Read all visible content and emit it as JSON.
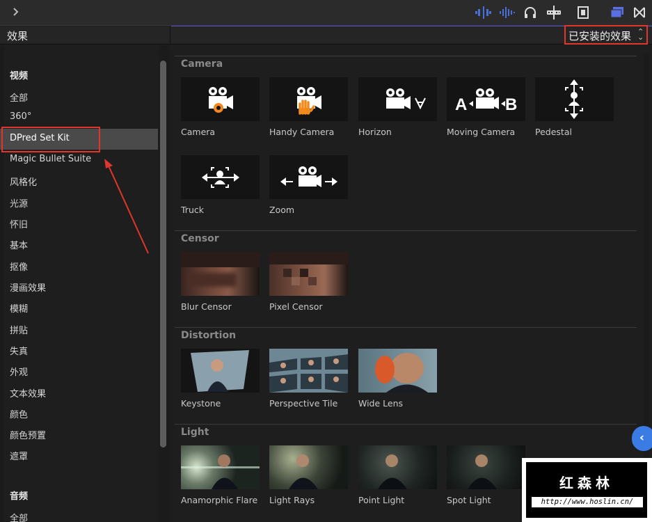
{
  "toolbar": {
    "icons": [
      "chevron-right-icon",
      "audio-waveform-split-icon",
      "audio-waveform-icon",
      "headphones-icon",
      "skimming-icon",
      "film-strip-icon",
      "browser-window-icon",
      "transitions-icon"
    ],
    "accent": "#5a4fcf"
  },
  "header": {
    "title": "效果",
    "filter_label": "已安装的效果",
    "filter_arrows": "⌃⌄"
  },
  "sidebar": {
    "video_heading": "视频",
    "items": [
      "全部",
      "360°",
      "DPred Set Kit",
      "Magic Bullet Suite",
      "风格化",
      "光源",
      "怀旧",
      "基本",
      "抠像",
      "漫画效果",
      "模糊",
      "拼贴",
      "失真",
      "外观",
      "文本效果",
      "颜色",
      "颜色预置",
      "遮罩"
    ],
    "selected": "DPred Set Kit",
    "audio_heading": "音频",
    "audio_items": [
      "全部"
    ]
  },
  "sections": [
    {
      "title": "Camera",
      "tiles": [
        "Camera",
        "Handy Camera",
        "Horizon",
        "Moving Camera",
        "Pedestal",
        "Truck",
        "Zoom"
      ]
    },
    {
      "title": "Censor",
      "tiles": [
        "Blur Censor",
        "Pixel Censor"
      ]
    },
    {
      "title": "Distortion",
      "tiles": [
        "Keystone",
        "Perspective Tile",
        "Wide Lens"
      ]
    },
    {
      "title": "Light",
      "tiles": [
        "Anamorphic Flare",
        "Light Rays",
        "Point Light",
        "Spot Light"
      ]
    }
  ],
  "highlight_color": "#e0362c",
  "collapse_button": "‹",
  "watermark": {
    "title": "红森林",
    "url": "http://www.hoslin.cn/"
  }
}
